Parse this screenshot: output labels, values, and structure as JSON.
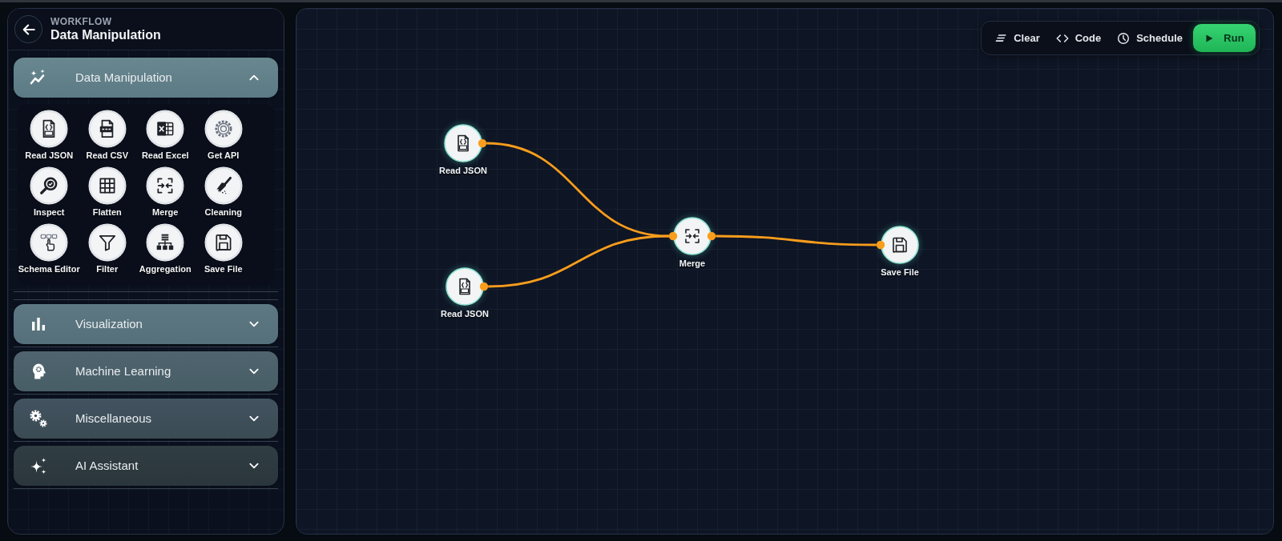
{
  "header": {
    "eyebrow": "WORKFLOW",
    "title": "Data Manipulation"
  },
  "categories": [
    {
      "label": "Data Manipulation",
      "expanded": true,
      "tools": [
        {
          "label": "Read JSON"
        },
        {
          "label": "Read CSV"
        },
        {
          "label": "Read Excel"
        },
        {
          "label": "Get API"
        },
        {
          "label": "Inspect"
        },
        {
          "label": "Flatten"
        },
        {
          "label": "Merge"
        },
        {
          "label": "Cleaning"
        },
        {
          "label": "Schema Editor"
        },
        {
          "label": "Filter"
        },
        {
          "label": "Aggregation"
        },
        {
          "label": "Save File"
        }
      ]
    },
    {
      "label": "Visualization",
      "expanded": false
    },
    {
      "label": "Machine Learning",
      "expanded": false
    },
    {
      "label": "Miscellaneous",
      "expanded": false
    },
    {
      "label": "AI Assistant",
      "expanded": false
    }
  ],
  "toolbar": [
    {
      "label": "Clear",
      "kind": "plain"
    },
    {
      "label": "Code",
      "kind": "plain"
    },
    {
      "label": "Schedule",
      "kind": "plain"
    },
    {
      "label": "Run",
      "kind": "primary"
    }
  ],
  "canvas": {
    "nodes": [
      {
        "label": "Read JSON"
      },
      {
        "label": "Read JSON"
      },
      {
        "label": "Merge"
      },
      {
        "label": "Save File"
      }
    ]
  }
}
